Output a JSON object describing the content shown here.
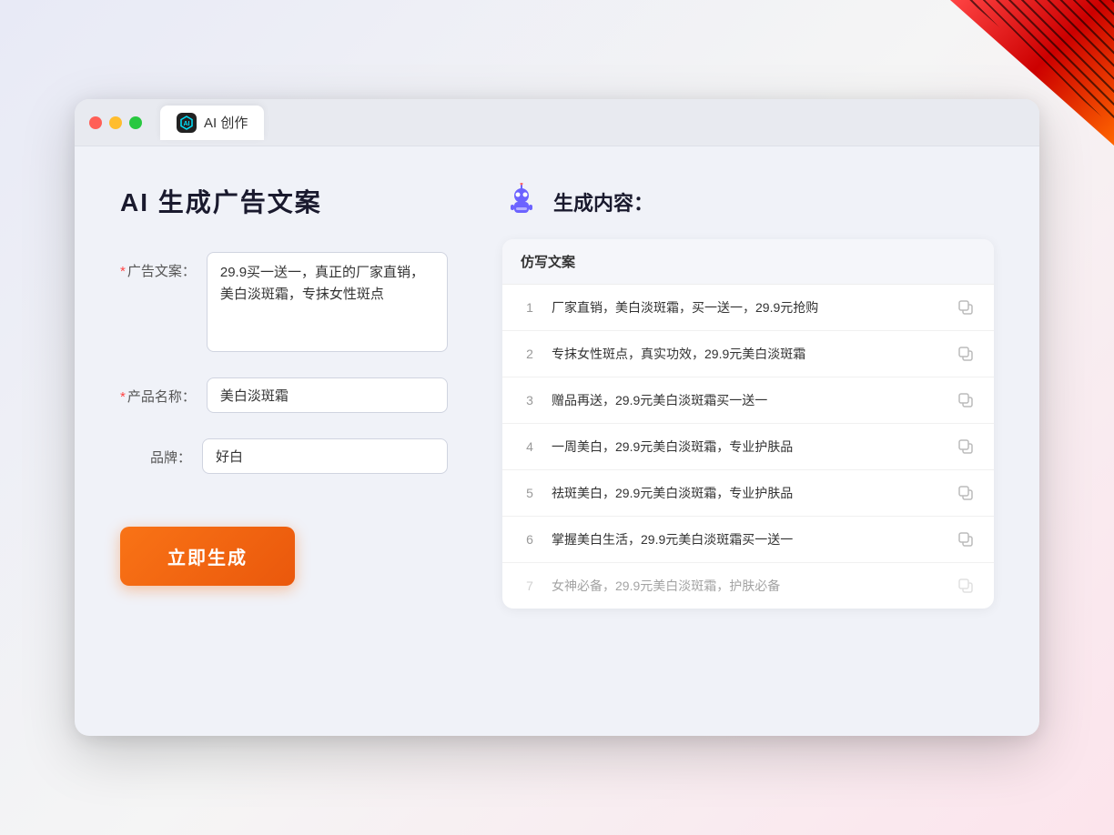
{
  "corner": {
    "visible": true
  },
  "titleBar": {
    "tabTitle": "AI 创作",
    "tabIconText": "AI"
  },
  "leftPanel": {
    "pageTitle": "AI 生成广告文案",
    "form": {
      "adCopyLabel": "广告文案：",
      "adCopyRequired": true,
      "adCopyValue": "29.9买一送一，真正的厂家直销，美白淡斑霜，专抹女性斑点",
      "productNameLabel": "产品名称：",
      "productNameRequired": true,
      "productNameValue": "美白淡斑霜",
      "brandLabel": "品牌：",
      "brandRequired": false,
      "brandValue": "好白"
    },
    "generateButton": "立即生成"
  },
  "rightPanel": {
    "resultTitle": "生成内容：",
    "columnHeader": "仿写文案",
    "results": [
      {
        "num": "1",
        "text": "厂家直销，美白淡斑霜，买一送一，29.9元抢购",
        "faded": false
      },
      {
        "num": "2",
        "text": "专抹女性斑点，真实功效，29.9元美白淡斑霜",
        "faded": false
      },
      {
        "num": "3",
        "text": "赠品再送，29.9元美白淡斑霜买一送一",
        "faded": false
      },
      {
        "num": "4",
        "text": "一周美白，29.9元美白淡斑霜，专业护肤品",
        "faded": false
      },
      {
        "num": "5",
        "text": "祛斑美白，29.9元美白淡斑霜，专业护肤品",
        "faded": false
      },
      {
        "num": "6",
        "text": "掌握美白生活，29.9元美白淡斑霜买一送一",
        "faded": false
      },
      {
        "num": "7",
        "text": "女神必备，29.9元美白淡斑霜，护肤必备",
        "faded": true
      }
    ]
  }
}
